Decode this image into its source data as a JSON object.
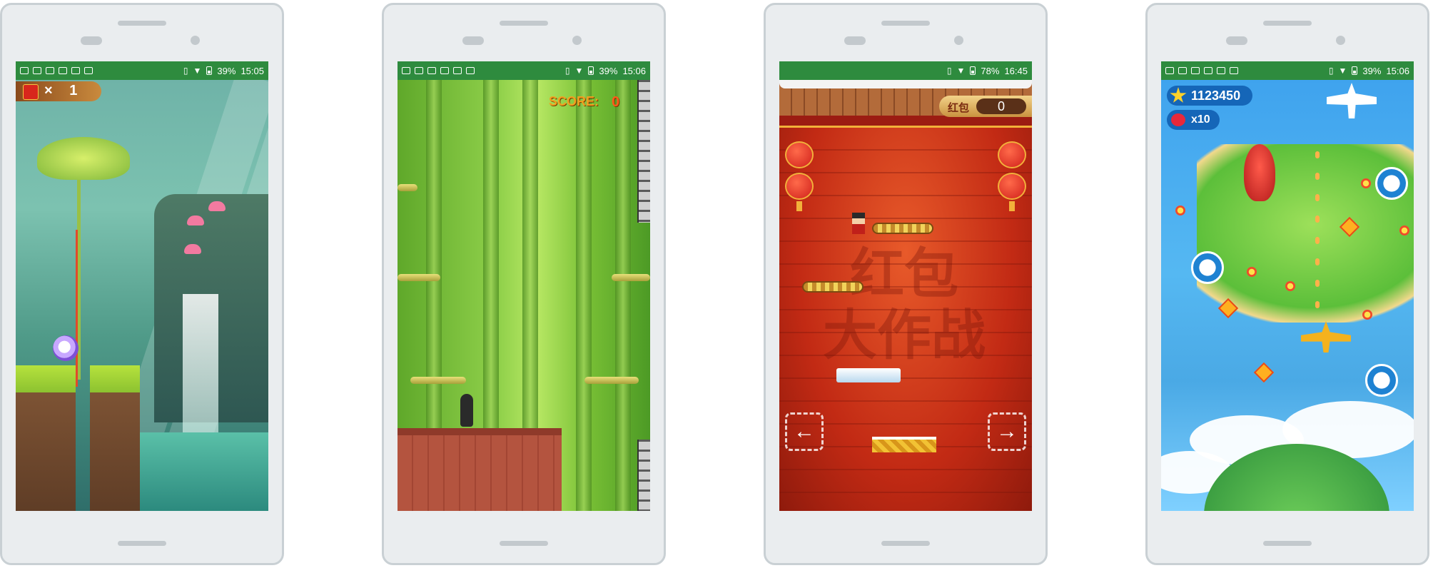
{
  "phones": [
    {
      "status_bar": {
        "battery": "39%",
        "time": "15:05"
      },
      "game": {
        "multiplier_prefix": "×",
        "count": "1"
      }
    },
    {
      "status_bar": {
        "battery": "39%",
        "time": "15:06"
      },
      "game": {
        "score_label": "SCORE:",
        "score_value": "0"
      }
    },
    {
      "status_bar": {
        "battery": "78%",
        "time": "16:45"
      },
      "game": {
        "hud_label": "红包",
        "hud_value": "0",
        "watermark_line1": "红包",
        "watermark_line2": "大作战",
        "left_arrow": "←",
        "right_arrow": "→"
      }
    },
    {
      "status_bar": {
        "battery": "39%",
        "time": "15:06"
      },
      "game": {
        "score": "1123450",
        "lives": "x10"
      }
    }
  ],
  "colors": {
    "status_bar": "#2e8b3e",
    "phone_body": "#eaedef",
    "phone_border": "#c9d0d4"
  },
  "icons": [
    "notification-icon",
    "image-icon",
    "signal-icon",
    "vibrate-icon",
    "wifi-icon",
    "battery-icon",
    "arrow-left-icon",
    "arrow-right-icon",
    "star-icon",
    "heart-icon",
    "red-envelope-icon"
  ]
}
